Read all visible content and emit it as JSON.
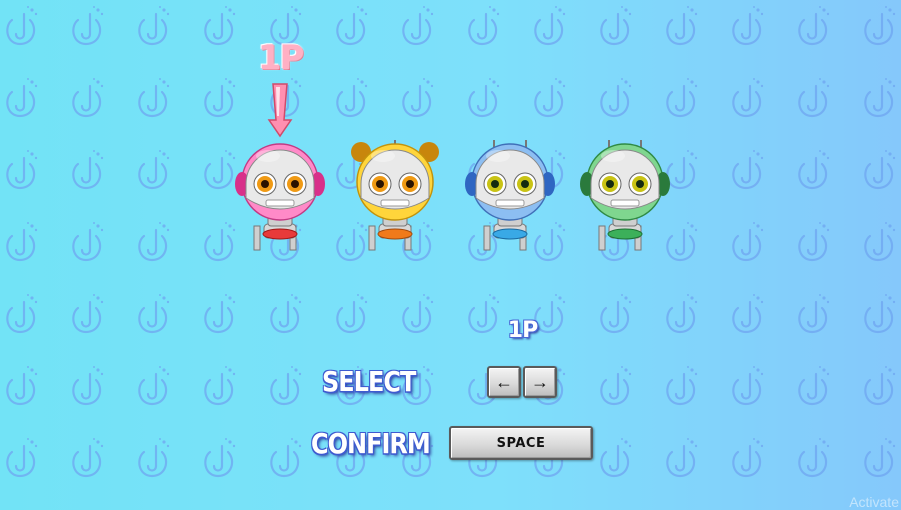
{
  "cursor_label": "1P",
  "player_indicator": "1P",
  "characters": [
    {
      "name": "pink-robot",
      "accent": "#e0529a",
      "light": "#ff9bd0",
      "belt": "#e83a3a"
    },
    {
      "name": "yellow-robot",
      "accent": "#e9b214",
      "light": "#ffe36b",
      "belt": "#f07a1a"
    },
    {
      "name": "blue-robot",
      "accent": "#3f7fd0",
      "light": "#9cc8f5",
      "belt": "#39a9e6"
    },
    {
      "name": "green-robot",
      "accent": "#2f9a4c",
      "light": "#8fe09f",
      "belt": "#3cb05a"
    }
  ],
  "selected_index": 0,
  "controls": {
    "select_label": "SELECT",
    "confirm_label": "CONFIRM",
    "left_key": "←",
    "right_key": "→",
    "confirm_key": "SPACE"
  },
  "watermark": "Activate",
  "colors": {
    "background_left": "#72e3f6",
    "background_right": "#85c8fb",
    "pattern": "#6ea6f0",
    "label_outline": "#3e5ad0"
  }
}
